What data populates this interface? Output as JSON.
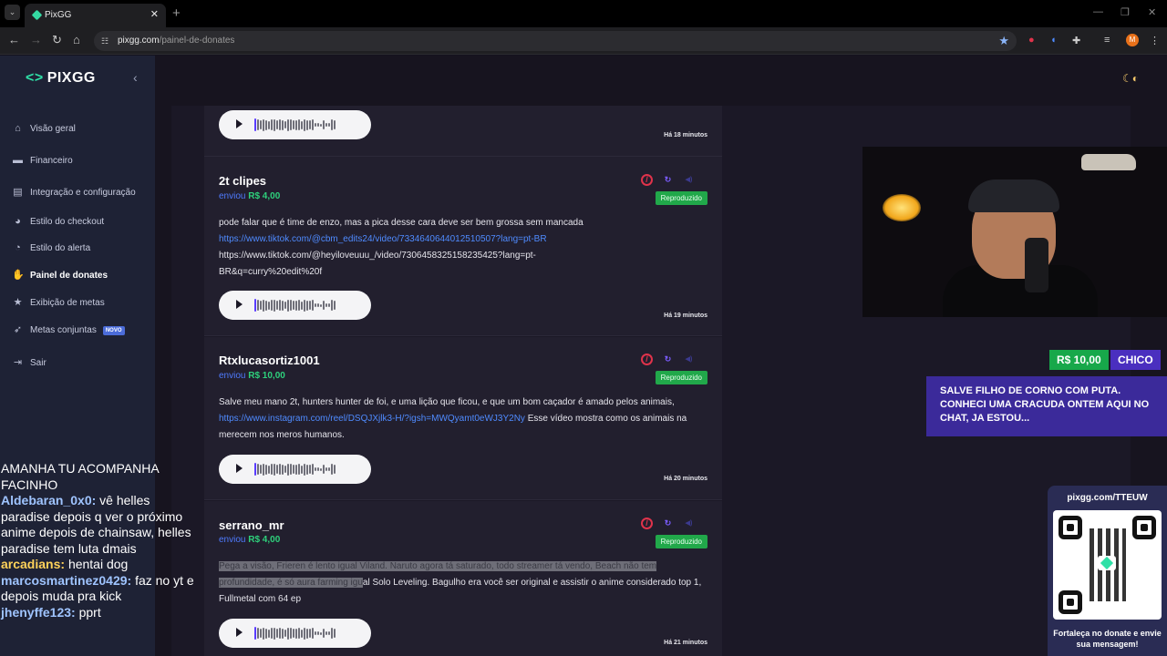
{
  "browser": {
    "tab_title": "PixGG",
    "tab_close": "✕",
    "new_tab": "+",
    "url_host": "pixgg.com",
    "url_path": "/painel-de-donates",
    "profile_initial": "M"
  },
  "sidebar": {
    "logo": "PIXGG",
    "collapse": "‹",
    "items": [
      {
        "label": "Visão geral"
      },
      {
        "label": "Financeiro"
      },
      {
        "label": "Integração e configuração"
      },
      {
        "label": "Estilo do checkout"
      },
      {
        "label": "Estilo do alerta"
      },
      {
        "label": "Painel de donates"
      },
      {
        "label": "Exibição de metas"
      },
      {
        "label": "Metas conjuntas",
        "badge": "NOVO"
      },
      {
        "label": "Sair"
      }
    ]
  },
  "donations": {
    "sent_label": "enviou",
    "status_label": "Reproduzido",
    "first_time": "Há 18 minutos",
    "items": [
      {
        "name": "2t clipes",
        "amount": "R$ 4,00",
        "msg_text": "pode falar que é time de enzo, mas a pica desse cara deve ser bem grossa sem mancada",
        "msg_link": "https://www.tiktok.com/@cbm_edits24/video/7334640644012510507?lang=pt-BR",
        "msg_text2": "https://www.tiktok.com/@heyiloveuuu_/video/7306458325158235425?lang=pt-BR&q=curry%20edit%20f",
        "time": "Há 19 minutos"
      },
      {
        "name": "Rtxlucasortiz1001",
        "amount": "R$ 10,00",
        "msg_text": "Salve meu mano 2t, hunters hunter de foi, e uma lição que ficou, e que um bom caçador é amado pelos animais,",
        "msg_link": "https://www.instagram.com/reel/DSQJXjlk3-H/?igsh=MWQyamt0eWJ3Y2Ny",
        "msg_text2": "Esse vídeo mostra como os animais na merecem nos meros humanos.",
        "time": "Há 20 minutos"
      },
      {
        "name": "serrano_mr",
        "amount": "R$ 4,00",
        "msg_highlight": "Pega a visão, Frieren é lento igual Viland. Naruto agora tá saturado, todo streamer tá vendo, Beach não tem profundidade, é só aura farming igu",
        "msg_text": "al Solo Leveling. Bagulho era você ser original e assistir o anime considerado top 1, Fullmetal com 64 ep",
        "time": "Há 21 minutos"
      }
    ]
  },
  "alert": {
    "amount": "R$ 10,00",
    "name": "CHICO",
    "message": "SALVE FILHO DE CORNO COM PUTA. CONHECI UMA CRACUDA ONTEM AQUI NO CHAT, JA ESTOU..."
  },
  "chat": [
    {
      "user": "",
      "text": "AMANHA TU ACOMPANHA FACINHO"
    },
    {
      "user": "Aldebaran_0x0:",
      "text": "vê helles paradise depois q ver o próximo anime depois de chainsaw, helles paradise tem luta dmais"
    },
    {
      "user": "arcadians:",
      "text": "hentai dog"
    },
    {
      "user": "marcosmartinez0429:",
      "text": "faz no yt e depois muda pra kick"
    },
    {
      "user": "jhenyffe123:",
      "text": "pprt"
    }
  ],
  "qr": {
    "title": "pixgg.com/TTEUW",
    "footer": "Fortaleça no donate e envie sua mensagem!"
  }
}
